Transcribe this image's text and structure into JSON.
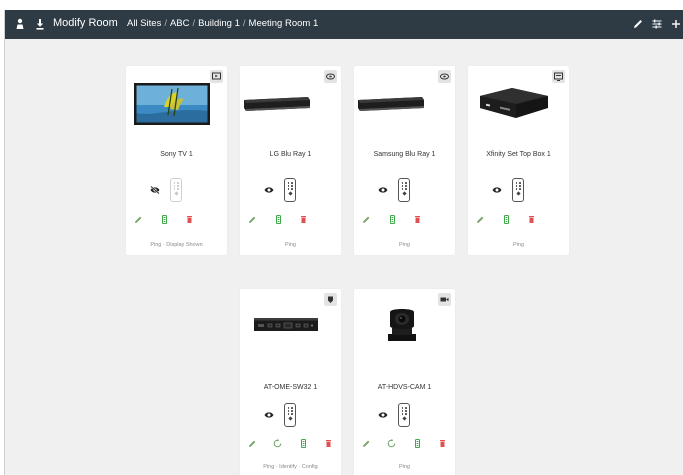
{
  "header": {
    "title": "Modify Room",
    "breadcrumbs": [
      "All Sites",
      "ABC",
      "Building 1",
      "Meeting Room 1"
    ],
    "separator": "/"
  },
  "colors": {
    "topbar": "#2e3b44",
    "edit": "#7aa36a",
    "refresh": "#6aa36a",
    "settings": "#3ea84a",
    "delete": "#e05050"
  },
  "devices": [
    {
      "name": "Sony TV 1",
      "type_icon": "display-icon",
      "footer": "Ping · Display Shown",
      "visibility": "hidden"
    },
    {
      "name": "LG Blu Ray 1",
      "type_icon": "disc-player-icon",
      "footer": "Ping",
      "visibility": "visible"
    },
    {
      "name": "Samsung Blu Ray 1",
      "type_icon": "disc-player-icon",
      "footer": "Ping",
      "visibility": "visible"
    },
    {
      "name": "Xfinity Set Top Box 1",
      "type_icon": "set-top-box-icon",
      "footer": "Ping",
      "visibility": "visible"
    },
    {
      "name": "AT-OME-SW32 1",
      "type_icon": "switcher-icon",
      "footer": "Ping · Identify · Config",
      "visibility": "visible"
    },
    {
      "name": "AT-HDVS-CAM 1",
      "type_icon": "camera-icon",
      "footer": "Ping",
      "visibility": "visible"
    }
  ]
}
